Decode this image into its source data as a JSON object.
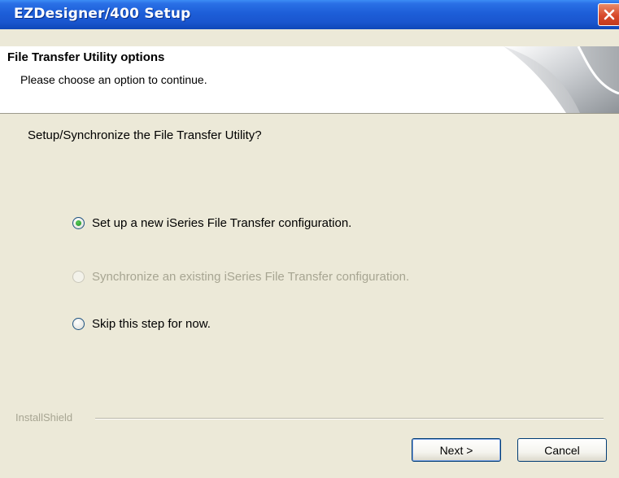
{
  "window": {
    "title": "EZDesigner/400 Setup",
    "close_icon": "close-icon"
  },
  "header": {
    "title": "File Transfer Utility options",
    "subtitle": "Please choose an option to continue."
  },
  "prompt": "Setup/Synchronize the File Transfer Utility?",
  "options": [
    {
      "label": "Set up a new iSeries File Transfer configuration.",
      "checked": true,
      "enabled": true
    },
    {
      "label": "Synchronize an existing iSeries File Transfer configuration.",
      "checked": false,
      "enabled": false
    },
    {
      "label": "Skip this step for now.",
      "checked": false,
      "enabled": true
    }
  ],
  "footer": {
    "brand": "InstallShield"
  },
  "buttons": {
    "next": "Next >",
    "cancel": "Cancel"
  }
}
